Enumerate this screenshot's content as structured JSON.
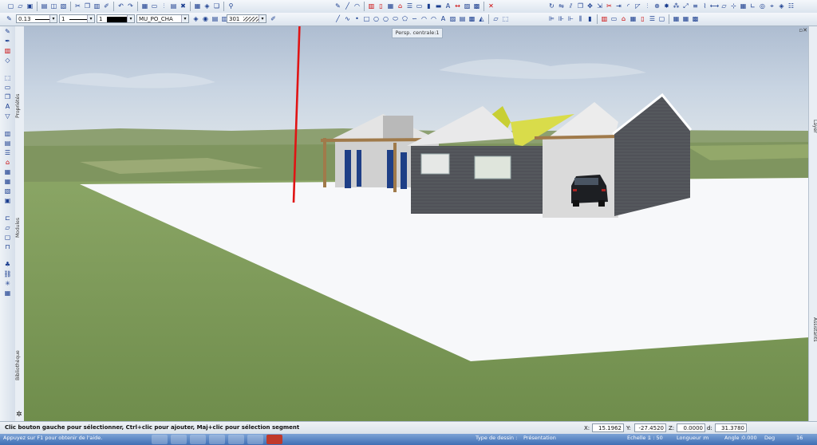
{
  "toolbar": {
    "line_width": "0.13",
    "line_style_num": "1",
    "pen_num": "1",
    "layer_name": "MU_PO_CHA",
    "pattern_num": "301"
  },
  "viewport": {
    "view_tab_label": "Persp. centrale:1",
    "window_controls": "▫✕"
  },
  "side_tabs": {
    "left": [
      "Propriétés",
      "Modules",
      "Bibliothèque"
    ],
    "right": [
      "Layer",
      "Assistants"
    ]
  },
  "status": {
    "message": "Clic bouton gauche pour sélectionner, Ctrl+clic pour ajouter, Maj+clic pour sélection segment",
    "x_label": "X:",
    "x_value": "15.1962",
    "y_label": "Y:",
    "y_value": "-27.4520",
    "z_label": "Z:",
    "z_value": "0.0000",
    "d_label": "d:",
    "d_value": "31.3780"
  },
  "taskbar": {
    "left_text": "Appuyez sur F1 pour obtenir de l'aide.",
    "drawing_type_label": "Type de dessin :",
    "drawing_type_value": "Présentation",
    "scale_label": "Echelle :",
    "scale_value": "1 : 50",
    "length_label": "Longueur :",
    "length_value": "m",
    "angle_label": "Angle :",
    "angle_value": "0.000",
    "unit": "Deg",
    "zoom": "16"
  },
  "colors": {
    "sky": "#b5c7dc",
    "grass": "#7e9a58",
    "slab": "#f7f8fa",
    "cladding": "#55585d",
    "wall": "#d8d8d8",
    "accent_yellow": "#c8cf34",
    "door_blue": "#1e3f86",
    "arrow_red": "#e01414"
  },
  "icons": {
    "tb1_left": [
      "new-icon",
      "open-icon",
      "save-icon",
      "sep",
      "print-icon",
      "preview-icon",
      "plot-icon",
      "sep",
      "cut-icon",
      "copy-icon",
      "paste-icon",
      "match-icon",
      "sep",
      "undo-icon",
      "redo-icon",
      "sep",
      "window-icon",
      "frame-icon",
      "split-icon",
      "print-icon",
      "tools-icon",
      "sep",
      "grid-icon",
      "layers-icon",
      "3d-icon",
      "sep",
      "zoom-icon"
    ],
    "tb1_mid": [
      "pencil-icon",
      "line-icon",
      "arc-icon",
      "sep",
      "wall-icon",
      "door-icon",
      "window-icon",
      "roof-icon",
      "stair-icon",
      "slab-icon",
      "column-icon",
      "beam-icon",
      "text-icon",
      "dimension-icon",
      "hatch-icon",
      "fill-icon",
      "sep",
      "delete-icon"
    ],
    "tb1_right": [
      "rotate-icon",
      "mirror-icon",
      "offset-icon",
      "copy-icon",
      "move-icon",
      "stretch-icon",
      "trim-icon",
      "extend-icon",
      "fillet-icon",
      "chamfer-icon",
      "split-icon",
      "join-icon",
      "explode-icon",
      "array-icon",
      "scale-icon",
      "align-icon",
      "break-icon",
      "measure-icon",
      "area-icon",
      "snap-icon",
      "grid-icon",
      "ortho-icon",
      "polar-icon",
      "track-icon",
      "layer-icon",
      "property-icon"
    ],
    "tb2_draw": [
      "line-icon",
      "spline-icon",
      "point-icon",
      "rectangle-icon",
      "circle-icon",
      "circle-icon",
      "ellipse-icon",
      "polygon-icon",
      "curve-icon",
      "arc-icon",
      "arc-icon",
      "text-icon",
      "hatch-icon",
      "pattern-icon",
      "fill-icon",
      "bucket-icon",
      "sep",
      "area-icon",
      "select-icon"
    ],
    "tb2_right": [
      "align-left-icon",
      "align-center-icon",
      "align-right-icon",
      "distribute-icon",
      "column-icon",
      "sep",
      "wall-icon",
      "slab-icon",
      "roof-icon",
      "window-icon",
      "door-icon",
      "stair-icon",
      "room-icon",
      "sep",
      "grid-icon",
      "table-icon",
      "matrix-icon"
    ],
    "left": [
      "pencil-icon",
      "pen-icon",
      "wall-icon",
      "opening-icon",
      "sep",
      "select-icon",
      "frame-icon",
      "copy-icon",
      "text-icon",
      "filter-icon",
      "sep",
      "building-icon",
      "floor-icon",
      "stair-icon",
      "roof-icon",
      "grid-icon",
      "table-icon",
      "sheet-icon",
      "stamp-icon",
      "sep",
      "section-icon",
      "area-icon",
      "room-icon",
      "elevation-icon",
      "sep",
      "tree-icon",
      "link-icon",
      "star-icon",
      "grid-icon"
    ]
  }
}
